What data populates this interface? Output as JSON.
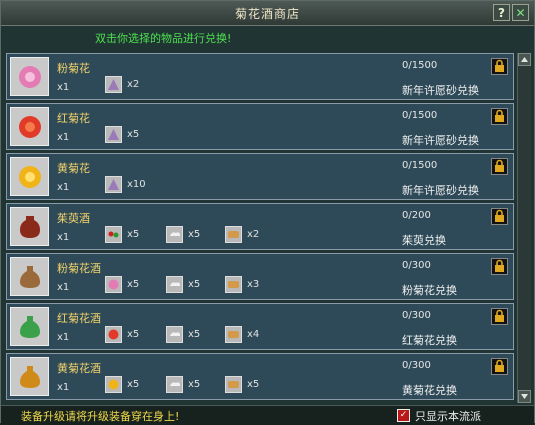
{
  "window": {
    "title": "菊花酒商店",
    "help_label": "?",
    "close_label": "✕"
  },
  "hint": "双击你选择的物品进行兑换!",
  "items": [
    {
      "name": "粉菊花",
      "qty": "x1",
      "icon": "pink-chrysanthemum-icon",
      "color": "#e47bb5",
      "costs": [
        {
          "icon": "wish-sand-icon",
          "count": "x2"
        }
      ],
      "stock": "0/1500",
      "exchange": "新年许愿砂兑换"
    },
    {
      "name": "红菊花",
      "qty": "x1",
      "icon": "red-chrysanthemum-icon",
      "color": "#e23a28",
      "costs": [
        {
          "icon": "wish-sand-icon",
          "count": "x5"
        }
      ],
      "stock": "0/1500",
      "exchange": "新年许愿砂兑换"
    },
    {
      "name": "黄菊花",
      "qty": "x1",
      "icon": "yellow-chrysanthemum-icon",
      "color": "#f0b418",
      "costs": [
        {
          "icon": "wish-sand-icon",
          "count": "x10"
        }
      ],
      "stock": "0/1500",
      "exchange": "新年许愿砂兑换"
    },
    {
      "name": "茱萸酒",
      "qty": "x1",
      "icon": "dogwood-wine-icon",
      "color": "#8a2a1a",
      "costs": [
        {
          "icon": "dogwood-icon",
          "count": "x5"
        },
        {
          "icon": "cloud-icon",
          "count": "x5"
        },
        {
          "icon": "scroll-icon",
          "count": "x2"
        }
      ],
      "stock": "0/200",
      "exchange": "茱萸兑换"
    },
    {
      "name": "粉菊花酒",
      "qty": "x1",
      "icon": "pink-wine-icon",
      "color": "#9a6a3a",
      "costs": [
        {
          "icon": "pink-chrysanthemum-icon",
          "count": "x5"
        },
        {
          "icon": "cloud-icon",
          "count": "x5"
        },
        {
          "icon": "scroll-icon",
          "count": "x3"
        }
      ],
      "stock": "0/300",
      "exchange": "粉菊花兑换"
    },
    {
      "name": "红菊花酒",
      "qty": "x1",
      "icon": "red-wine-icon",
      "color": "#3aa04a",
      "costs": [
        {
          "icon": "red-chrysanthemum-icon",
          "count": "x5"
        },
        {
          "icon": "cloud-icon",
          "count": "x5"
        },
        {
          "icon": "scroll-icon",
          "count": "x4"
        }
      ],
      "stock": "0/300",
      "exchange": "红菊花兑换"
    },
    {
      "name": "黄菊花酒",
      "qty": "x1",
      "icon": "yellow-wine-icon",
      "color": "#d08a1a",
      "costs": [
        {
          "icon": "yellow-chrysanthemum-icon",
          "count": "x5"
        },
        {
          "icon": "cloud-icon",
          "count": "x5"
        },
        {
          "icon": "scroll-icon",
          "count": "x5"
        }
      ],
      "stock": "0/300",
      "exchange": "黄菊花兑换"
    }
  ],
  "footer": {
    "tip": "装备升级请将升级装备穿在身上!",
    "checkbox_label": "只显示本流派",
    "checked": true
  }
}
